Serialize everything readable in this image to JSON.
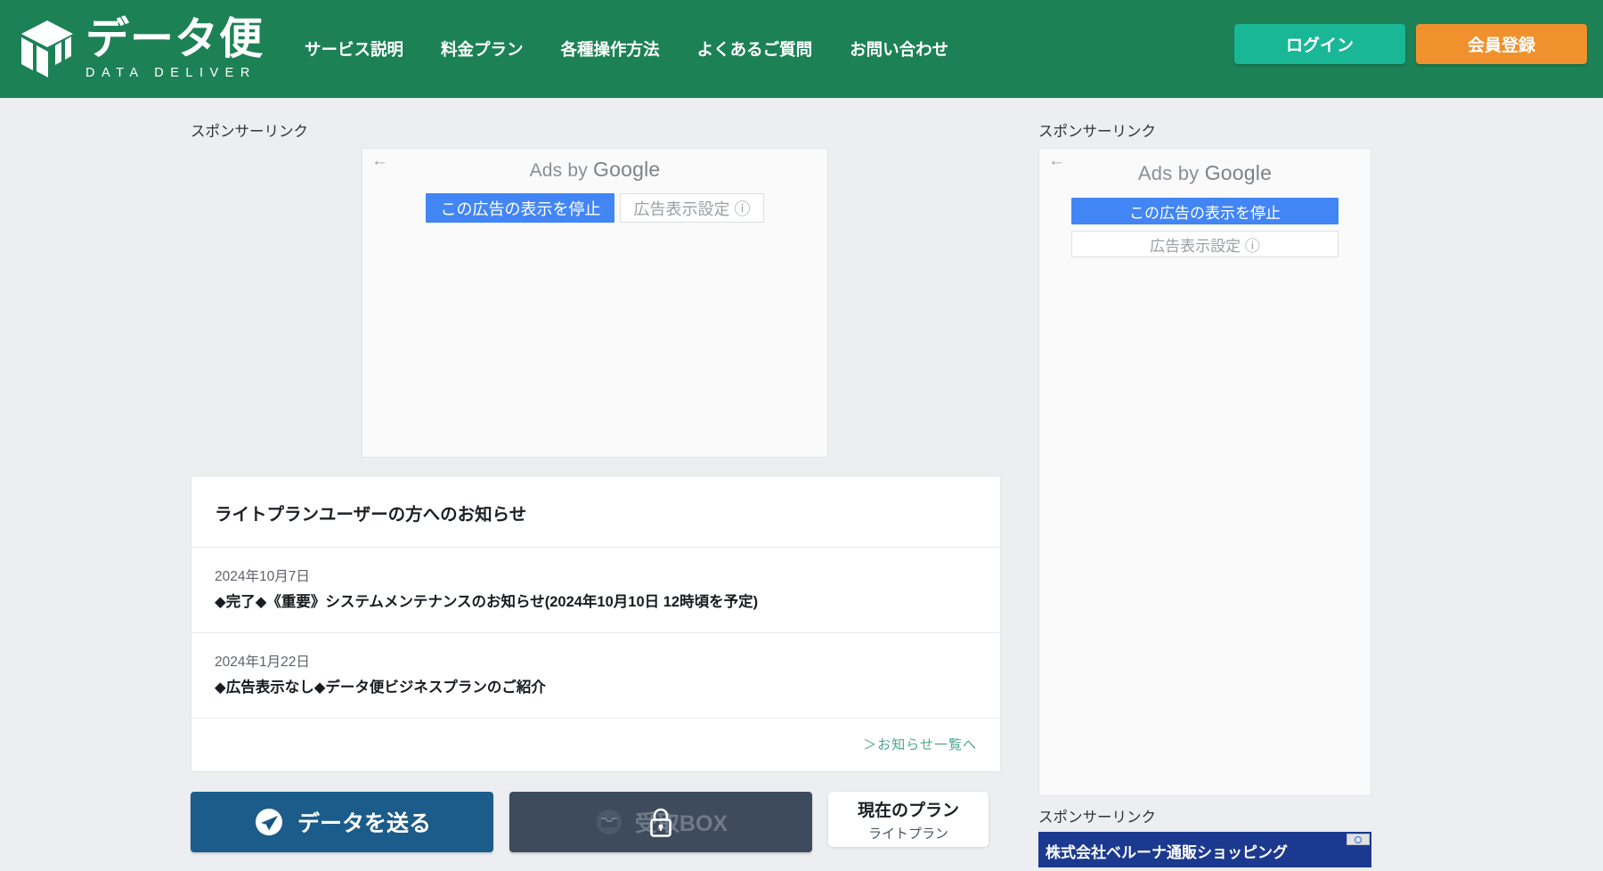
{
  "header": {
    "logo_jp": "データ便",
    "logo_en": "DATA DELIVER",
    "nav": [
      {
        "label": "サービス説明"
      },
      {
        "label": "料金プラン"
      },
      {
        "label": "各種操作方法"
      },
      {
        "label": "よくあるご質問"
      },
      {
        "label": "お問い合わせ"
      }
    ],
    "login_label": "ログイン",
    "signup_label": "会員登録",
    "bg_color": "#1d8156",
    "login_color": "#19b796",
    "signup_color": "#f0912d"
  },
  "sponsor": {
    "label_center": "スポンサーリンク",
    "label_right_top": "スポンサーリンク",
    "label_right_bottom": "スポンサーリンク"
  },
  "ad_center": {
    "back_arrow": "←",
    "ads_by": "Ads by",
    "ads_brand": "Google",
    "stop_label": "この広告の表示を停止",
    "settings_label": "広告表示設定 ⓘ",
    "accent_color": "#4285f4"
  },
  "ad_right": {
    "back_arrow": "←",
    "ads_by": "Ads by",
    "ads_brand": "Google",
    "stop_label": "この広告の表示を停止",
    "settings_label": "広告表示設定 ⓘ"
  },
  "notice": {
    "title": "ライトプランユーザーの方へのお知らせ",
    "items": [
      {
        "date": "2024年10月7日",
        "text": "◆完了◆《重要》システムメンテナンスのお知らせ(2024年10月10日 12時頃を予定)"
      },
      {
        "date": "2024年1月22日",
        "text": "◆広告表示なし◆データ便ビジネスプランのご紹介"
      }
    ],
    "more_label": "＞お知らせ一覧へ"
  },
  "actions": {
    "send_label": "データを送る",
    "box_label": "受取BOX",
    "plan_title": "現在のプラン",
    "plan_name": "ライトプラン",
    "send_color": "#1b5c8a",
    "box_color": "#3d4b5c"
  },
  "bottom_ad": {
    "banner_text": "株式会社ベルーナ通販ショッピング"
  }
}
